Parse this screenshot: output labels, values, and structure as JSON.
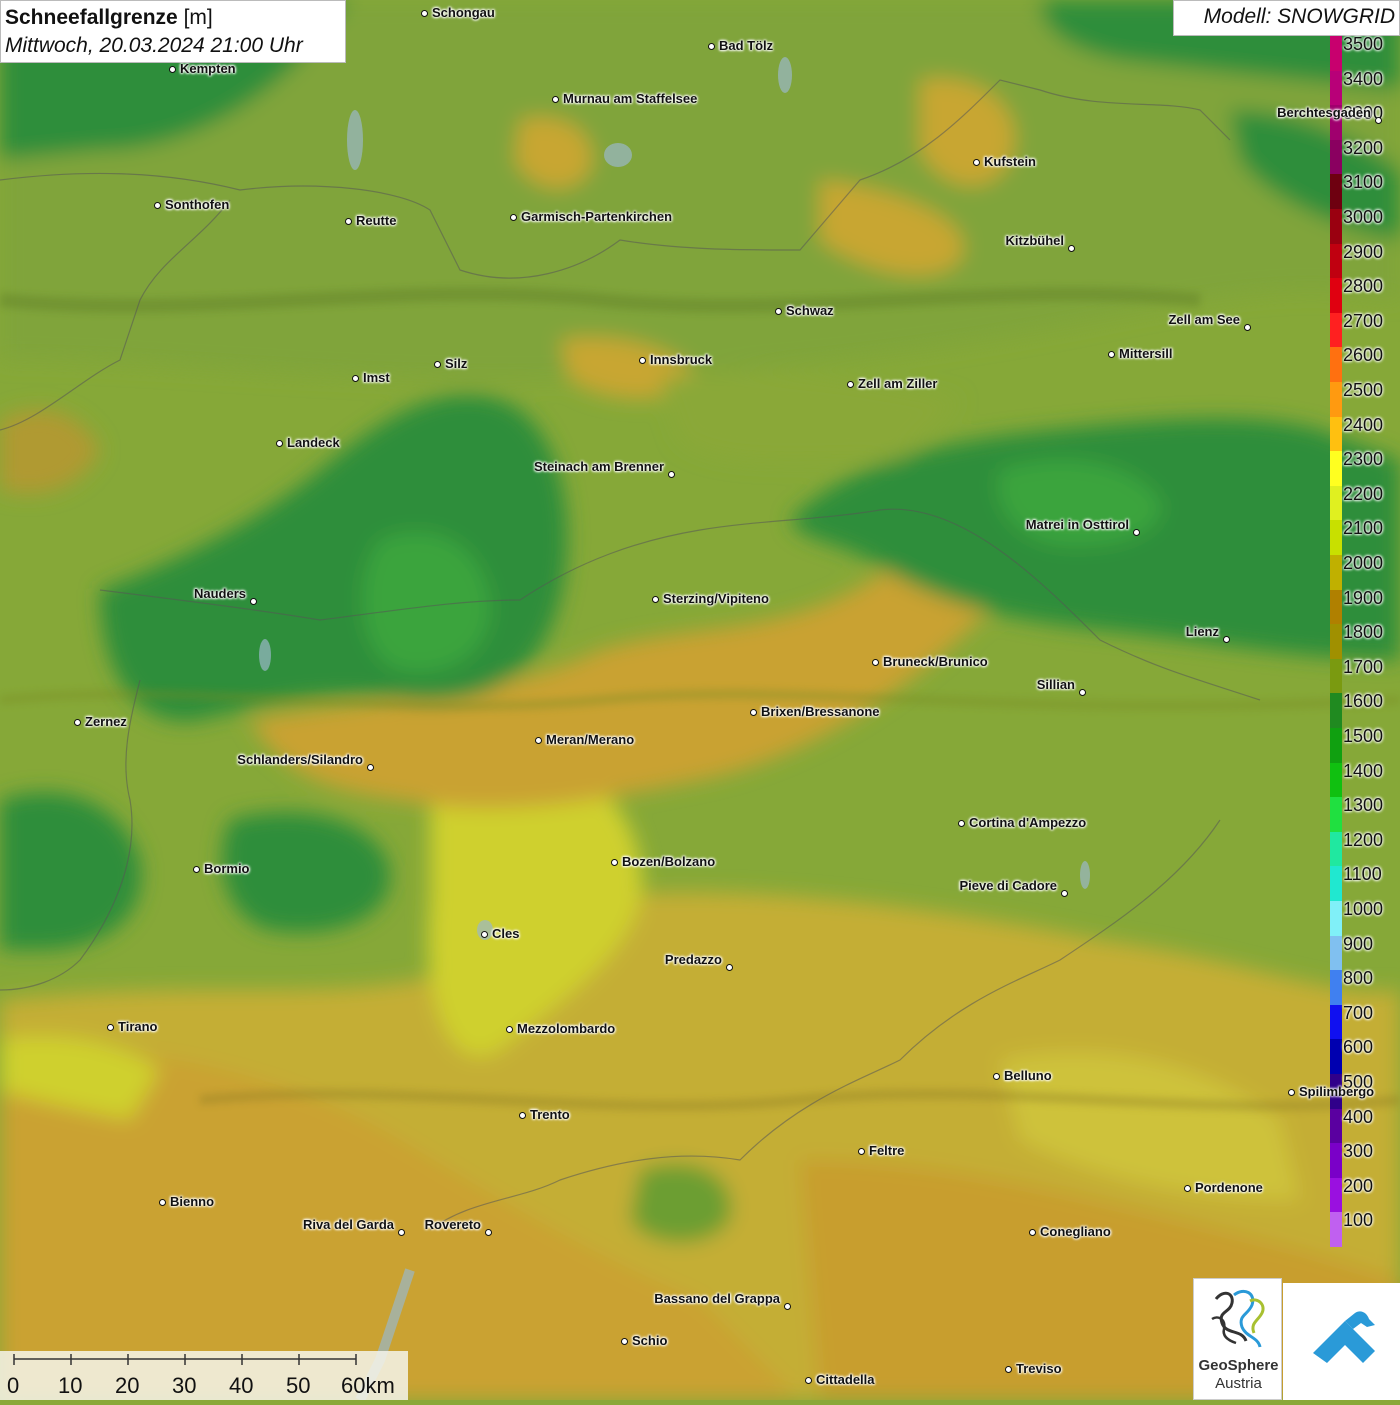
{
  "title": {
    "parameter": "Schneefallgrenze",
    "unit": "[m]",
    "datetime": "Mittwoch, 20.03.2024 21:00 Uhr"
  },
  "model": "Modell: SNOWGRID",
  "legend": {
    "labels": [
      "3500",
      "3400",
      "3300",
      "3200",
      "3100",
      "3000",
      "2900",
      "2800",
      "2700",
      "2600",
      "2500",
      "2400",
      "2300",
      "2200",
      "2100",
      "2000",
      "1900",
      "1800",
      "1700",
      "1600",
      "1500",
      "1400",
      "1300",
      "1200",
      "1100",
      "1000",
      "900",
      "800",
      "700",
      "600",
      "500",
      "400",
      "300",
      "200",
      "100"
    ],
    "colors": [
      "#c8006e",
      "#b80078",
      "#a0006e",
      "#8a0060",
      "#6e0010",
      "#9a0010",
      "#c00010",
      "#e00010",
      "#ff2020",
      "#ff7010",
      "#ff9a10",
      "#ffc010",
      "#ffff20",
      "#e0f020",
      "#c8e000",
      "#c0b000",
      "#b08000",
      "#a09000",
      "#7a9a10",
      "#208a20",
      "#10a010",
      "#10c010",
      "#20e040",
      "#20e8a0",
      "#20e8d0",
      "#80f0f8",
      "#80c0f0",
      "#4080f0",
      "#1010f0",
      "#0000b0",
      "#30008a",
      "#5a00a0",
      "#7a00c8",
      "#9a10e0",
      "#c060f0"
    ]
  },
  "cities": [
    {
      "name": "Schongau"
    },
    {
      "name": "Kempten"
    },
    {
      "name": "Bad Tölz"
    },
    {
      "name": "Murnau am Staffelsee"
    },
    {
      "name": "Berchtesgaden"
    },
    {
      "name": "Kufstein"
    },
    {
      "name": "Sonthofen"
    },
    {
      "name": "Reutte"
    },
    {
      "name": "Garmisch-Partenkirchen"
    },
    {
      "name": "Kitzbühel"
    },
    {
      "name": "Schwaz"
    },
    {
      "name": "Zell am See"
    },
    {
      "name": "Mittersill"
    },
    {
      "name": "Imst"
    },
    {
      "name": "Silz"
    },
    {
      "name": "Innsbruck"
    },
    {
      "name": "Zell am Ziller"
    },
    {
      "name": "Landeck"
    },
    {
      "name": "Steinach am Brenner"
    },
    {
      "name": "Matrei in Osttirol"
    },
    {
      "name": "Nauders"
    },
    {
      "name": "Sterzing/Vipiteno"
    },
    {
      "name": "Lienz"
    },
    {
      "name": "Bruneck/Brunico"
    },
    {
      "name": "Sillian"
    },
    {
      "name": "Zernez"
    },
    {
      "name": "Brixen/Bressanone"
    },
    {
      "name": "Meran/Merano"
    },
    {
      "name": "Schlanders/Silandro"
    },
    {
      "name": "Cortina d'Ampezzo"
    },
    {
      "name": "Bozen/Bolzano"
    },
    {
      "name": "Bormio"
    },
    {
      "name": "Pieve di Cadore"
    },
    {
      "name": "Cles"
    },
    {
      "name": "Predazzo"
    },
    {
      "name": "Tirano"
    },
    {
      "name": "Mezzolombardo"
    },
    {
      "name": "Belluno"
    },
    {
      "name": "Spilimbergo"
    },
    {
      "name": "Trento"
    },
    {
      "name": "Feltre"
    },
    {
      "name": "Pordenone"
    },
    {
      "name": "Bienno"
    },
    {
      "name": "Riva del Garda"
    },
    {
      "name": "Rovereto"
    },
    {
      "name": "Conegliano"
    },
    {
      "name": "Bassano del Grappa"
    },
    {
      "name": "Schio"
    },
    {
      "name": "Treviso"
    },
    {
      "name": "Cittadella"
    }
  ],
  "scalebar": {
    "ticks": [
      "0",
      "10",
      "20",
      "30",
      "40",
      "50",
      "60km"
    ]
  },
  "logos": {
    "geosphere_line1": "GeoSphere",
    "geosphere_line2": "Austria"
  }
}
